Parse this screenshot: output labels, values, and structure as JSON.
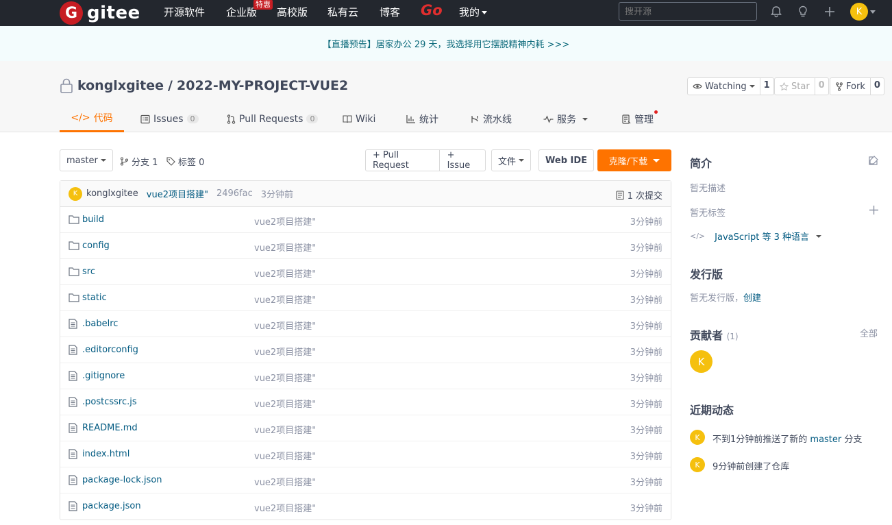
{
  "topnav": {
    "logo_letter": "G",
    "logo_text": "gitee",
    "items": [
      "开源软件",
      "企业版",
      "高校版",
      "私有云",
      "博客"
    ],
    "badge": "特惠",
    "go": "Go",
    "mine": "我的",
    "search_placeholder": "搜开源",
    "avatar_letter": "K"
  },
  "banner": {
    "text": "【直播预告】居家办公 29 天，我选择用它摆脱精神内耗 >>>"
  },
  "project": {
    "owner": "konglxgitee",
    "separator": "/",
    "name": "2022-MY-PROJECT-VUE2",
    "watch_label": "Watching",
    "watch_count": "1",
    "star_label": "Star",
    "star_count": "0",
    "fork_label": "Fork",
    "fork_count": "0"
  },
  "tabs": [
    {
      "label": "代码",
      "icon": "code-icon"
    },
    {
      "label": "Issues",
      "count": "0",
      "icon": "issues-icon"
    },
    {
      "label": "Pull Requests",
      "count": "0",
      "icon": "pull-request-icon"
    },
    {
      "label": "Wiki",
      "icon": "wiki-icon"
    },
    {
      "label": "统计",
      "icon": "stats-icon"
    },
    {
      "label": "流水线",
      "icon": "pipeline-icon"
    },
    {
      "label": "服务",
      "icon": "service-icon"
    },
    {
      "label": "管理",
      "icon": "manage-icon"
    }
  ],
  "toolbar": {
    "branch": "master",
    "branches": "分支 1",
    "tags": "标签 0",
    "pr_btn": "+ Pull Request",
    "issue_btn": "+ Issue",
    "file_btn": "文件",
    "webide_btn": "Web IDE",
    "clone_btn": "克隆/下载"
  },
  "commit": {
    "avatar_letter": "K",
    "author": "konglxgitee",
    "message": "vue2项目搭建\"",
    "hash": "2496fac",
    "time": "3分钟前",
    "commits": "1 次提交"
  },
  "files": [
    {
      "name": "build",
      "type": "folder",
      "message": "vue2项目搭建\"",
      "time": "3分钟前"
    },
    {
      "name": "config",
      "type": "folder",
      "message": "vue2项目搭建\"",
      "time": "3分钟前"
    },
    {
      "name": "src",
      "type": "folder",
      "message": "vue2项目搭建\"",
      "time": "3分钟前"
    },
    {
      "name": "static",
      "type": "folder",
      "message": "vue2项目搭建\"",
      "time": "3分钟前"
    },
    {
      "name": ".babelrc",
      "type": "file",
      "message": "vue2项目搭建\"",
      "time": "3分钟前"
    },
    {
      "name": ".editorconfig",
      "type": "file",
      "message": "vue2项目搭建\"",
      "time": "3分钟前"
    },
    {
      "name": ".gitignore",
      "type": "file",
      "message": "vue2项目搭建\"",
      "time": "3分钟前"
    },
    {
      "name": ".postcssrc.js",
      "type": "file",
      "message": "vue2项目搭建\"",
      "time": "3分钟前"
    },
    {
      "name": "README.md",
      "type": "file",
      "message": "vue2项目搭建\"",
      "time": "3分钟前"
    },
    {
      "name": "index.html",
      "type": "file",
      "message": "vue2项目搭建\"",
      "time": "3分钟前"
    },
    {
      "name": "package-lock.json",
      "type": "file",
      "message": "vue2项目搭建\"",
      "time": "3分钟前"
    },
    {
      "name": "package.json",
      "type": "file",
      "message": "vue2项目搭建\"",
      "time": "3分钟前"
    }
  ],
  "sidebar": {
    "intro_title": "简介",
    "no_desc": "暂无描述",
    "no_tags": "暂无标签",
    "lang": "JavaScript 等 3 种语言",
    "release_title": "发行版",
    "no_release": "暂无发行版，",
    "create_link": "创建",
    "contrib_title": "贡献者",
    "contrib_count": "(1)",
    "contrib_all": "全部",
    "contrib_avatar": "K",
    "activity_title": "近期动态",
    "activity": [
      {
        "avatar": "K",
        "pre": "不到1分钟前推送了新的 ",
        "link": "master",
        "post": " 分支"
      },
      {
        "avatar": "K",
        "pre": "9分钟前创建了仓库",
        "link": "",
        "post": ""
      }
    ]
  },
  "colors": {
    "accent": "#fe7300",
    "nav_bg": "#23272e",
    "link": "#005980",
    "avatar": "#f5c00e",
    "brand_red": "#c71d23"
  }
}
